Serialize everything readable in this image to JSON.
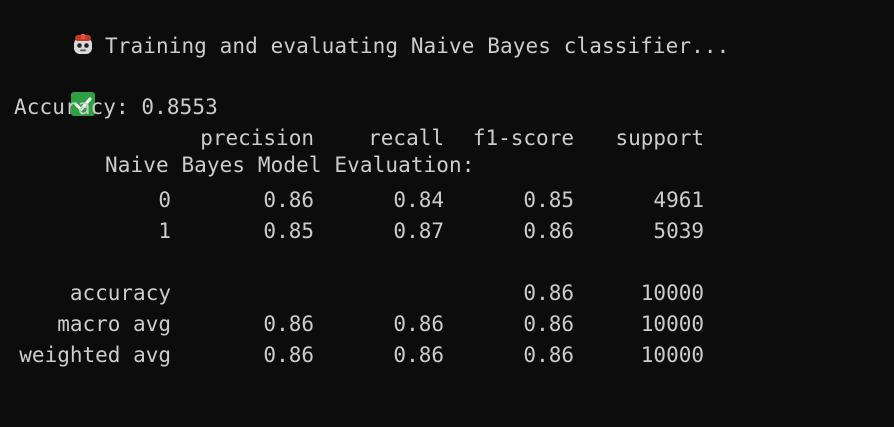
{
  "output": {
    "training_line": "Training and evaluating Naive Bayes classifier...",
    "eval_heading": "Naive Bayes Model Evaluation:",
    "accuracy_label": "Accuracy: 0.8553"
  },
  "icons": {
    "robot": "robot-icon",
    "check": "check-mark-icon"
  },
  "colors": {
    "background": "#0c0c0c",
    "text": "#cccccc",
    "check_green": "#2ea043"
  },
  "report": {
    "headers": [
      "precision",
      "recall",
      "f1-score",
      "support"
    ],
    "rows": [
      {
        "label": "0",
        "precision": "0.86",
        "recall": "0.84",
        "f1": "0.85",
        "support": "4961"
      },
      {
        "label": "1",
        "precision": "0.85",
        "recall": "0.87",
        "f1": "0.86",
        "support": "5039"
      },
      {
        "label": "accuracy",
        "precision": "",
        "recall": "",
        "f1": "0.86",
        "support": "10000"
      },
      {
        "label": "macro avg",
        "precision": "0.86",
        "recall": "0.86",
        "f1": "0.86",
        "support": "10000"
      },
      {
        "label": "weighted avg",
        "precision": "0.86",
        "recall": "0.86",
        "f1": "0.86",
        "support": "10000"
      }
    ]
  }
}
